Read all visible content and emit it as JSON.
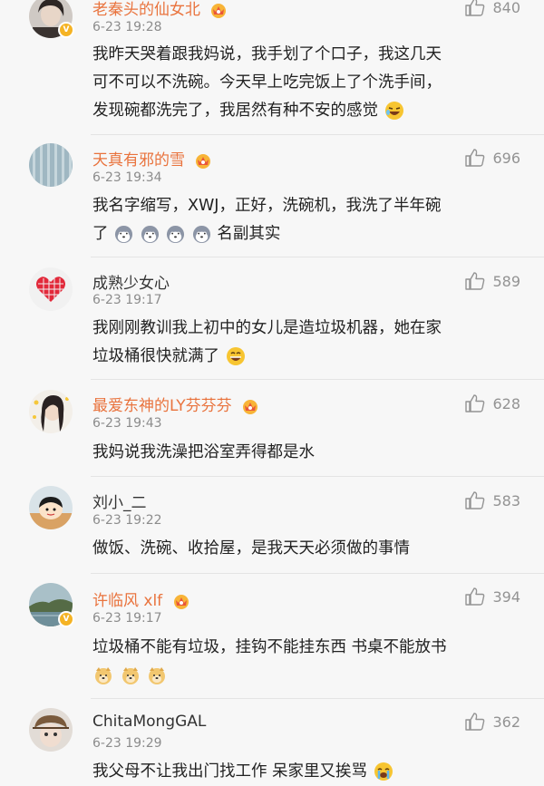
{
  "comments": [
    {
      "name": "老秦头的仙女北",
      "time": "6-23 19:28",
      "likes": "840",
      "lines": [
        "我昨天哭着跟我妈说，我手划了个口子，我这几天",
        "可不可以不洗碗。今天早上吃完饭上了个洗手间，",
        "发现碗都洗完了，我居然有种不安的感觉"
      ]
    },
    {
      "name": "天真有邪的雪",
      "time": "6-23 19:34",
      "likes": "696",
      "lines": [
        "我名字缩写，XWJ，正好，洗碗机，我洗了半年碗",
        "了",
        "名副其实"
      ]
    },
    {
      "name": "成熟少女心",
      "time": "6-23 19:17",
      "likes": "589",
      "lines": [
        "我刚刚教训我上初中的女儿是造垃圾机器，她在家",
        "垃圾桶很快就满了"
      ]
    },
    {
      "name": "最爱东神的LY芬芬芬",
      "time": "6-23 19:43",
      "likes": "628",
      "lines": [
        "我妈说我洗澡把浴室弄得都是水"
      ]
    },
    {
      "name": "刘小_二",
      "time": "6-23 19:22",
      "likes": "583",
      "lines": [
        "做饭、洗碗、收拾屋，是我天天必须做的事情"
      ]
    },
    {
      "name": "许临风 xlf",
      "time": "6-23 19:17",
      "likes": "394",
      "lines": [
        "垃圾桶不能有垃圾，挂钩不能挂东西 书桌不能放书"
      ]
    },
    {
      "name": "ChitaMongGAL",
      "time": "6-23 19:29",
      "likes": "362",
      "lines": [
        "我父母不让我出门找工作 呆家里又挨骂"
      ]
    }
  ],
  "icons": {
    "like": "thumbs-up-icon",
    "vip": "crown-vip-icon",
    "verified": "verified-badge-icon"
  },
  "colors": {
    "vip_name": "#e9733d",
    "time": "#8c8c8c",
    "like": "#939393",
    "background": "#f7f7f7"
  }
}
